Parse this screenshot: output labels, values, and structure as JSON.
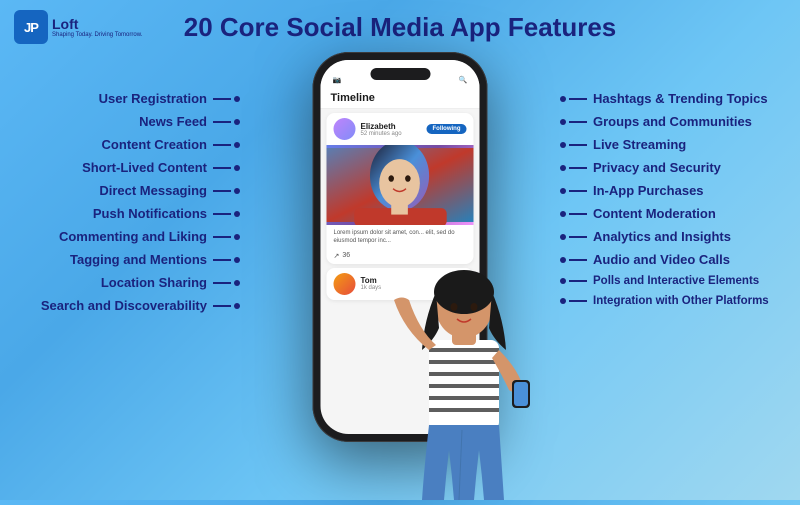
{
  "logo": {
    "icon": "JP",
    "name": "Loft",
    "tagline": "Shaping Today. Driving Tomorrow."
  },
  "title": "20 Core Social Media App Features",
  "left_features": [
    "User Registration",
    "News Feed",
    "Content Creation",
    "Short-Lived Content",
    "Direct Messaging",
    "Push Notifications",
    "Commenting and Liking",
    "Tagging and Mentions",
    "Location Sharing",
    "Search and Discoverability"
  ],
  "right_features": [
    "Hashtags & Trending Topics",
    "Groups and Communities",
    "Live Streaming",
    "Privacy and Security",
    "In-App Purchases",
    "Content Moderation",
    "Analytics and Insights",
    "Audio and Video Calls",
    "Polls and Interactive Elements",
    "Integration with Other Platforms"
  ],
  "phone": {
    "header": "Timeline",
    "post1": {
      "username": "Elizabeth",
      "time": "52 minutes ago",
      "follow": "Following",
      "caption": "Lorem ipsum dolor sit amet, con... elit, sed do eiusmod tempor inc...",
      "likes": "36"
    },
    "post2": {
      "username": "Tom",
      "time": "1k days"
    }
  }
}
